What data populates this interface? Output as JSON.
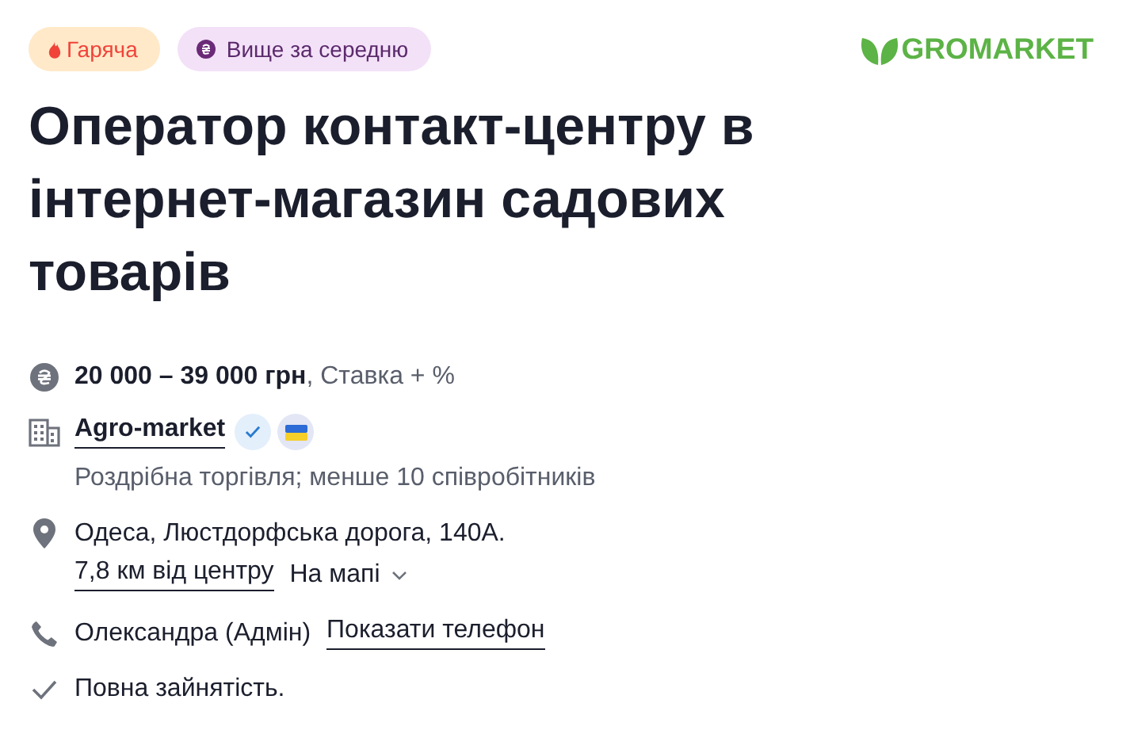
{
  "badges": [
    {
      "kind": "hot",
      "label": "Гаряча"
    },
    {
      "kind": "salary",
      "label": "Вище за середню"
    }
  ],
  "logo": {
    "text": "GROMARKET"
  },
  "title": "Оператор контакт-центру в інтернет-магазин садових товарів",
  "salary": {
    "amount": "20 000 – 39 000 грн",
    "note": ", Ставка + %"
  },
  "company": {
    "name": "Agro-market",
    "verified": true,
    "ukrainian": true,
    "description": "Роздрібна торгівля; менше 10 співробітників"
  },
  "location": {
    "address": "Одеса, Люстдорфська дорога, 140А.",
    "distance": "7,8 км від центру",
    "map_link": "На мапі",
    "expanded": false
  },
  "contact": {
    "name": "Олександра (Адмін)",
    "phone_link": "Показати телефон"
  },
  "employment": "Повна зайнятість."
}
